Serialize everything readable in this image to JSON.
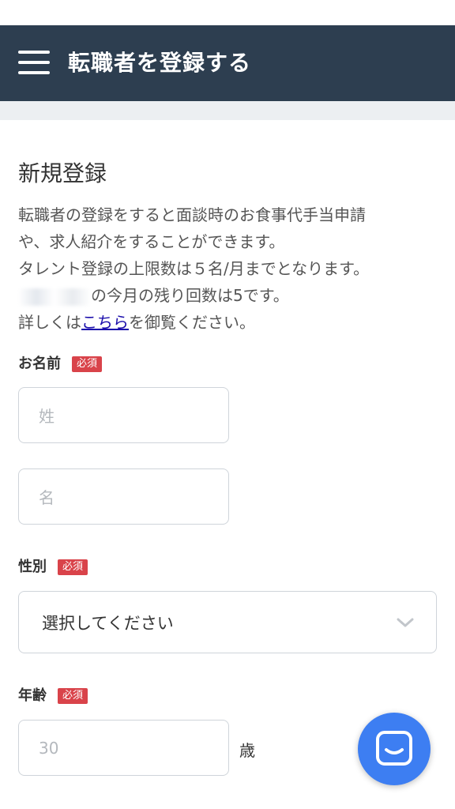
{
  "header": {
    "title": "転職者を登録する",
    "menu_icon": "hamburger-icon",
    "background_color": "#2d3e50"
  },
  "intro": {
    "title": "新規登録",
    "line1": "転職者の登録をすると面談時のお食事代手当申請",
    "line2": "や、求人紹介をすることができます。",
    "line3": "タレント登録の上限数は５名/月までとなります。",
    "line4_suffix": "の今月の残り回数は5です。",
    "line5_prefix": "詳しくは",
    "line5_link": "こちら",
    "line5_suffix": "を御覧ください。"
  },
  "form": {
    "name": {
      "label": "お名前",
      "required_badge": "必須",
      "last_name_placeholder": "姓",
      "first_name_placeholder": "名"
    },
    "gender": {
      "label": "性別",
      "required_badge": "必須",
      "selected_value": "選択してください",
      "dropdown_icon": "chevron-down-icon"
    },
    "age": {
      "label": "年齢",
      "required_badge": "必須",
      "placeholder": "30",
      "unit": "歳"
    }
  },
  "chat": {
    "icon": "chat-bubble-icon",
    "color": "#3d7ef2"
  },
  "colors": {
    "badge": "#d9434a",
    "link": "#1a0dab"
  }
}
